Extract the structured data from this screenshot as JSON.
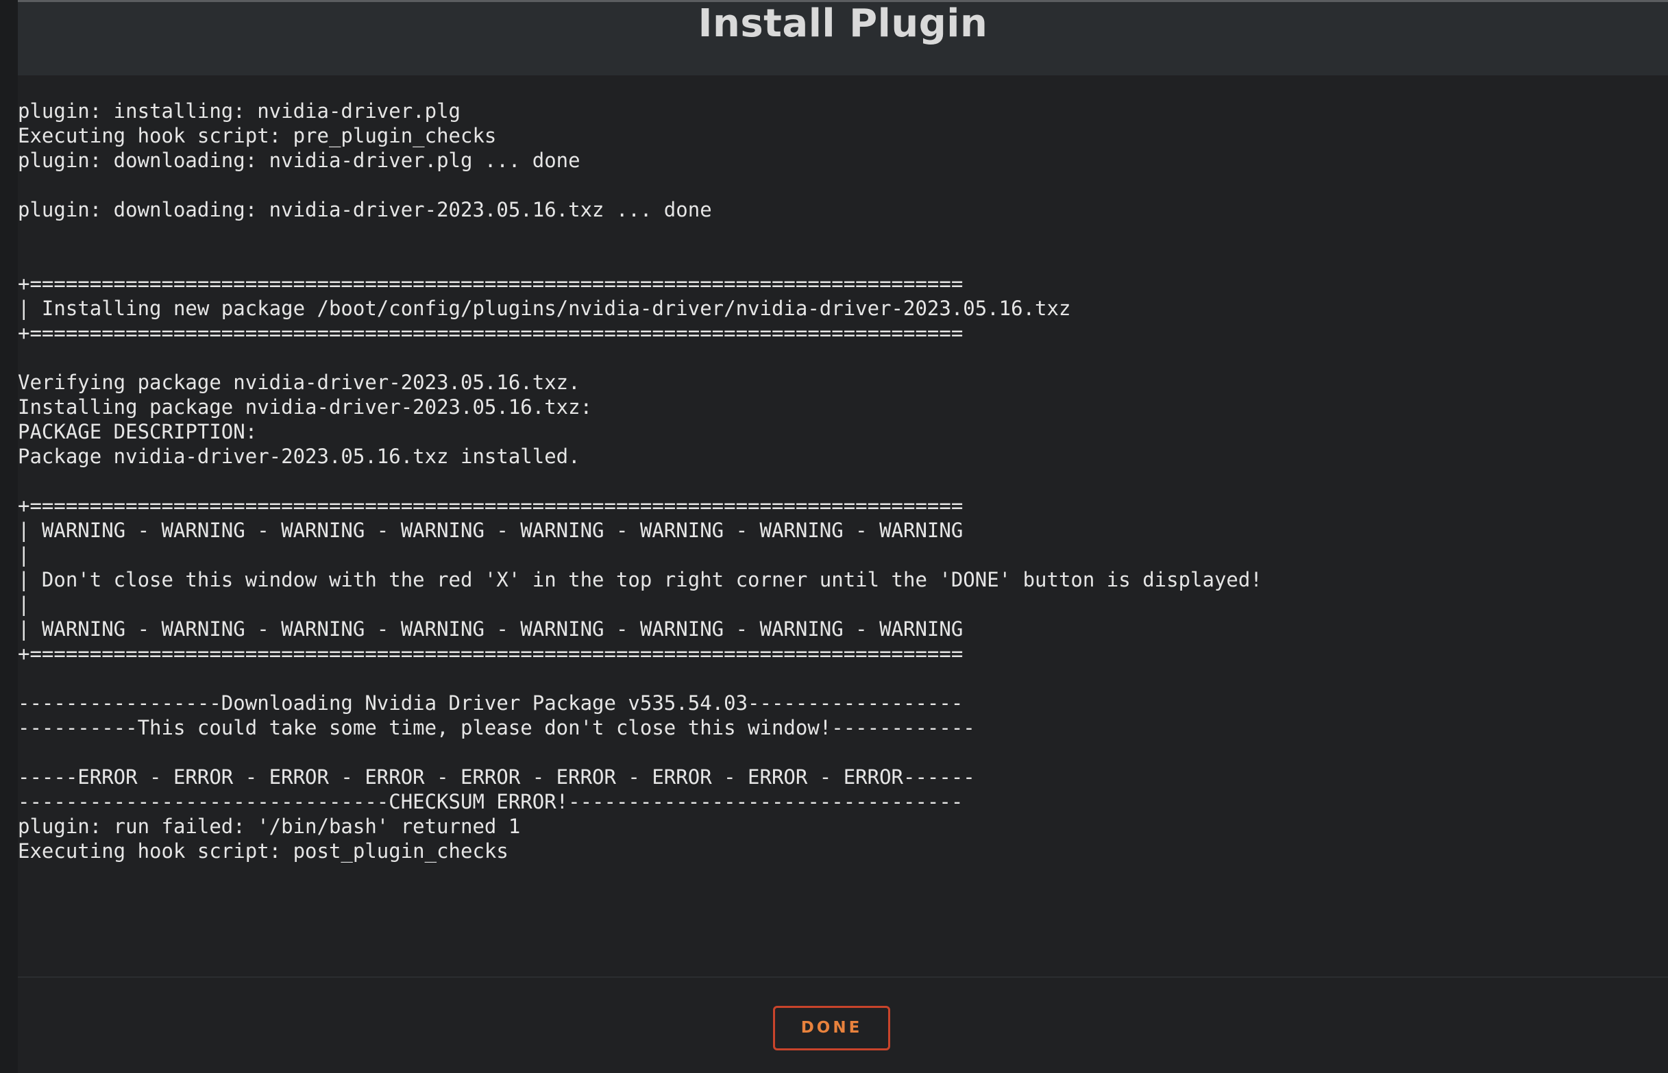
{
  "dialog": {
    "title": "Install Plugin",
    "done_label": "DONE"
  },
  "log": {
    "lines": [
      "plugin: installing: nvidia-driver.plg",
      "Executing hook script: pre_plugin_checks",
      "plugin: downloading: nvidia-driver.plg ... done",
      "plugin: downloading: nvidia-driver-2023.05.16.txz ... done",
      "+==============================================================================",
      "| Installing new package /boot/config/plugins/nvidia-driver/nvidia-driver-2023.05.16.txz",
      "+==============================================================================",
      "Verifying package nvidia-driver-2023.05.16.txz.",
      "Installing package nvidia-driver-2023.05.16.txz:",
      "PACKAGE DESCRIPTION:",
      "Package nvidia-driver-2023.05.16.txz installed.",
      "+==============================================================================",
      "| WARNING - WARNING - WARNING - WARNING - WARNING - WARNING - WARNING - WARNING",
      "|",
      "| Don't close this window with the red 'X' in the top right corner until the 'DONE' button is displayed!",
      "|",
      "| WARNING - WARNING - WARNING - WARNING - WARNING - WARNING - WARNING - WARNING",
      "+==============================================================================",
      "-----------------Downloading Nvidia Driver Package v535.54.03------------------",
      "----------This could take some time, please don't close this window!------------",
      "-----ERROR - ERROR - ERROR - ERROR - ERROR - ERROR - ERROR - ERROR - ERROR------",
      "-------------------------------CHECKSUM ERROR!---------------------------------",
      "plugin: run failed: '/bin/bash' returned 1",
      "Executing hook script: post_plugin_checks"
    ]
  }
}
